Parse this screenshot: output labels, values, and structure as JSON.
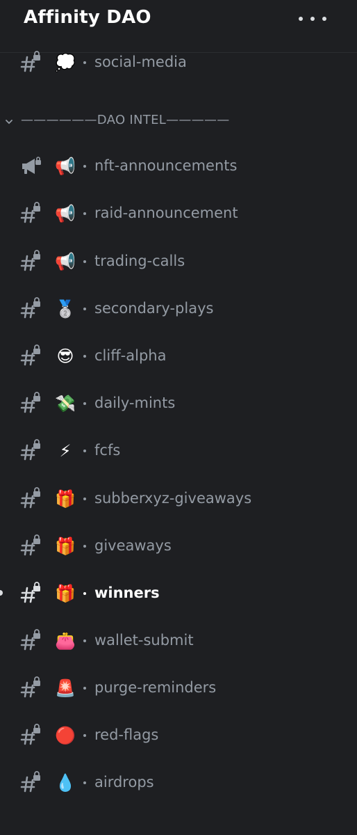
{
  "server": {
    "name": "Affinity DAO"
  },
  "header": {
    "more_icon": "ellipsis-icon"
  },
  "category": {
    "label": "——————DAO INTEL—————",
    "icon": "chevron-down-icon"
  },
  "channels": [
    {
      "name": "social-media",
      "emoji": "💭",
      "type": "locked-text"
    },
    {
      "name": "nft-announcements",
      "emoji": "📢",
      "type": "announcement"
    },
    {
      "name": "raid-announcement",
      "emoji": "📢",
      "type": "locked-text"
    },
    {
      "name": "trading-calls",
      "emoji": "📢",
      "type": "locked-text"
    },
    {
      "name": "secondary-plays",
      "emoji": "🥈",
      "type": "locked-text"
    },
    {
      "name": "cliff-alpha",
      "emoji": "😎",
      "type": "locked-text"
    },
    {
      "name": "daily-mints",
      "emoji": "💸",
      "type": "locked-text"
    },
    {
      "name": "fcfs",
      "emoji": "⚡",
      "type": "locked-text"
    },
    {
      "name": "subberxyz-giveaways",
      "emoji": "🎁",
      "type": "locked-text"
    },
    {
      "name": "giveaways",
      "emoji": "🎁",
      "type": "locked-text"
    },
    {
      "name": "winners",
      "emoji": "🎁",
      "type": "locked-text",
      "active": true
    },
    {
      "name": "wallet-submit",
      "emoji": "👛",
      "type": "locked-text"
    },
    {
      "name": "purge-reminders",
      "emoji": "🚨",
      "type": "locked-text"
    },
    {
      "name": "red-flags",
      "emoji": "🔴",
      "type": "locked-text"
    },
    {
      "name": "airdrops",
      "emoji": "💧",
      "type": "locked-text"
    }
  ],
  "colors": {
    "background": "#1e1f22",
    "text_muted": "#949ba4",
    "text_active": "#ffffff"
  }
}
